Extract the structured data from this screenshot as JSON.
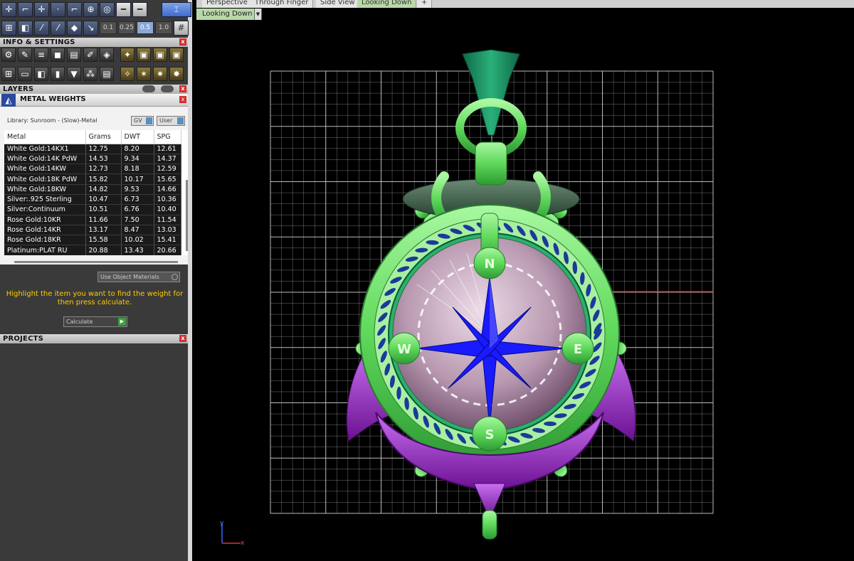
{
  "toolbar": {
    "row1": [
      "✛",
      "⌐",
      "✛",
      "·",
      "⌐",
      "⊕",
      "◎",
      "━",
      "━"
    ],
    "row2": [
      "⊞",
      "◧",
      "⁄",
      "⁄",
      "◆",
      "↘"
    ],
    "pills": [
      "0.1",
      "0.25",
      "0.5",
      "1.0"
    ],
    "active_pill": "0.5"
  },
  "sections": {
    "info_settings": "INFO & SETTINGS",
    "layers": "LAYERS",
    "projects": "PROJECTS",
    "close_glyph": "x"
  },
  "metal_weights": {
    "title": "METAL WEIGHTS",
    "library": "Library: Sunroom - (Slow)-Metal",
    "gv_label": "GV",
    "user_label": "User",
    "columns": [
      "Metal",
      "Grams",
      "DWT",
      "SPG"
    ],
    "rows": [
      [
        "White Gold:14KX1",
        "12.75",
        "8.20",
        "12.61"
      ],
      [
        "White Gold:14K PdW",
        "14.53",
        "9.34",
        "14.37"
      ],
      [
        "White Gold:14KW",
        "12.73",
        "8.18",
        "12.59"
      ],
      [
        "White Gold:18K PdW",
        "15.82",
        "10.17",
        "15.65"
      ],
      [
        "White Gold:18KW",
        "14.82",
        "9.53",
        "14.66"
      ],
      [
        "Silver:.925 Sterling",
        "10.47",
        "6.73",
        "10.36"
      ],
      [
        "Silver:Continuum",
        "10.51",
        "6.76",
        "10.40"
      ],
      [
        "Rose Gold:10KR",
        "11.66",
        "7.50",
        "11.54"
      ],
      [
        "Rose Gold:14KR",
        "13.17",
        "8.47",
        "13.03"
      ],
      [
        "Rose Gold:18KR",
        "15.58",
        "10.02",
        "15.41"
      ],
      [
        "Platinum:PLAT RU",
        "20.88",
        "13.43",
        "20.66"
      ]
    ],
    "use_object_materials": "Use Object Materials",
    "hint": "Highlight the item you want to find the weight for then press calculate.",
    "calculate": "Calculate"
  },
  "viewport": {
    "tabs": [
      "Perspective",
      "Through Finger",
      "Side View",
      "Looking Down",
      "+"
    ],
    "active_tab": "Looking Down",
    "view_label": "Looking Down",
    "compass": {
      "n": "N",
      "s": "S",
      "e": "E",
      "w": "W"
    },
    "axis": {
      "y": "y",
      "x": "x"
    }
  },
  "colors": {
    "green": "#6fe06a",
    "dark_green": "#1c8a5a",
    "purple": "#9a2ec8",
    "blue": "#1a1aff",
    "pink": "#b89ab0",
    "rope": "#1a3a9a",
    "grid": "#d0d0d0"
  }
}
